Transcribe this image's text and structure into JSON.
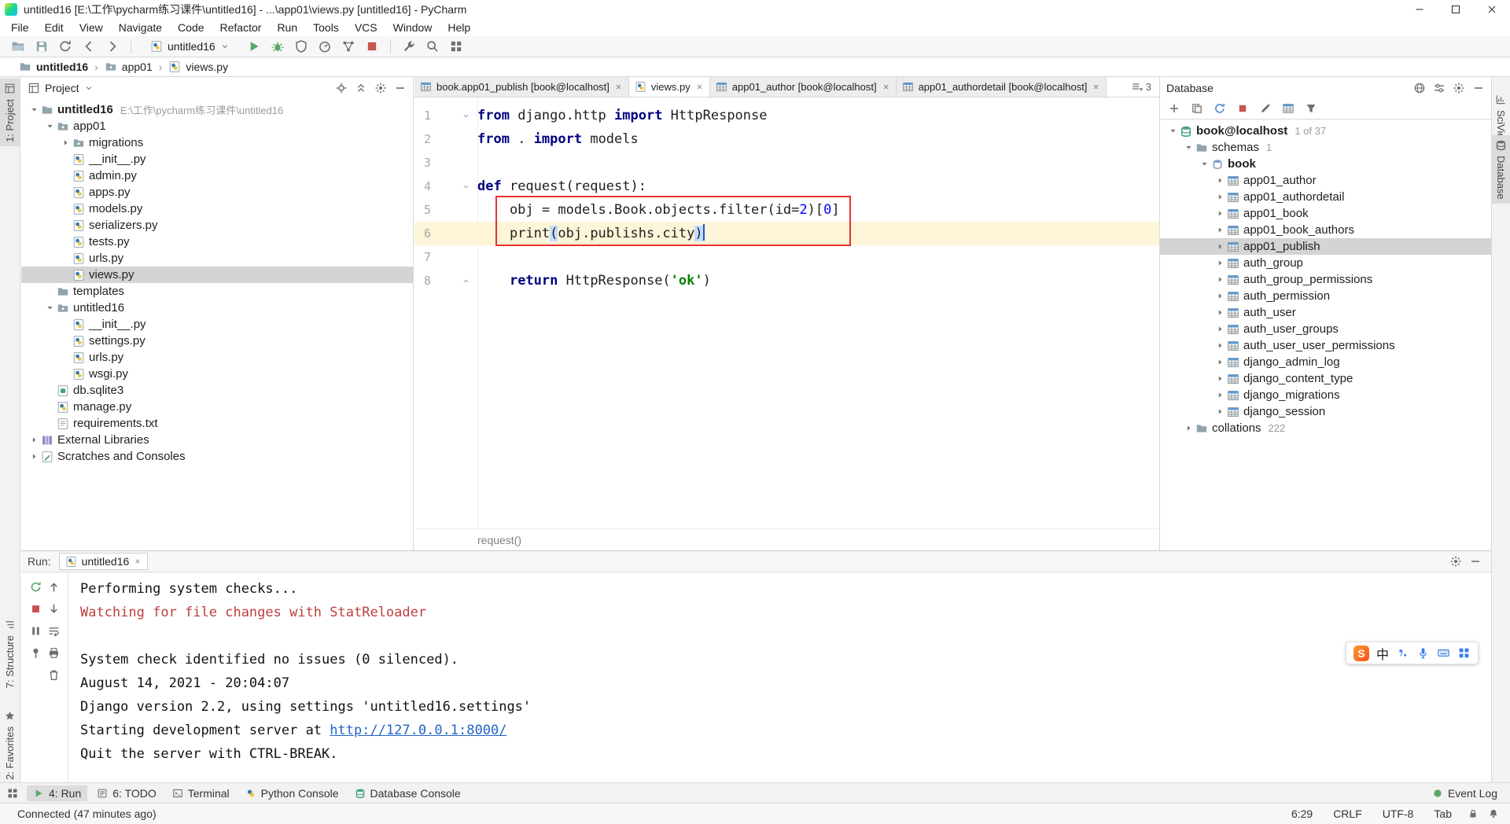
{
  "window": {
    "title": "untitled16 [E:\\工作\\pycharm练习课件\\untitled16] - ...\\app01\\views.py [untitled16] - PyCharm",
    "controls": [
      {
        "icon": "win-min",
        "name": "minimize-button"
      },
      {
        "icon": "win-max",
        "name": "maximize-button"
      },
      {
        "icon": "win-close",
        "name": "close-button"
      }
    ]
  },
  "menu": {
    "items": [
      "File",
      "Edit",
      "View",
      "Navigate",
      "Code",
      "Refactor",
      "Run",
      "Tools",
      "VCS",
      "Window",
      "Help"
    ]
  },
  "toolbar": {
    "file_icons": [
      "open",
      "save",
      "sync",
      "back",
      "forward"
    ],
    "run_config": {
      "icon": "python-file",
      "label": "untitled16"
    },
    "run_icons": [
      "run",
      "debug",
      "coverage",
      "profiler",
      "concurrency",
      "stop"
    ],
    "misc_icons": [
      "wrench",
      "search",
      "grid"
    ]
  },
  "breadcrumbs": {
    "separator": "›",
    "items": [
      {
        "icon": "folder",
        "label": "untitled16",
        "bold": true
      },
      {
        "icon": "package",
        "label": "app01",
        "bold": false
      },
      {
        "icon": "python-file",
        "label": "views.py",
        "bold": false
      }
    ]
  },
  "stripes": {
    "left": [
      {
        "icon": "project-tool",
        "label": "1: Project",
        "active": true
      },
      {
        "icon": "structure-tool",
        "label": "7: Structure",
        "active": false
      },
      {
        "icon": "favorites-tool",
        "label": "2: Favorites",
        "active": false
      }
    ],
    "right": [
      {
        "icon": "sciview-tool",
        "label": "SciView",
        "active": false
      },
      {
        "icon": "database-tool",
        "label": "Database",
        "active": true
      }
    ]
  },
  "project_panel": {
    "title": "Project",
    "header_icons": [
      "locate",
      "collapse-all",
      "settings",
      "hide"
    ],
    "tree": [
      {
        "lvl": 0,
        "exp": "v",
        "icon": "folder",
        "label": "untitled16",
        "extra": "E:\\工作\\pycharm练习课件\\untitled16",
        "bold": true
      },
      {
        "lvl": 1,
        "exp": "v",
        "icon": "package",
        "label": "app01"
      },
      {
        "lvl": 2,
        "exp": ">",
        "icon": "package",
        "label": "migrations"
      },
      {
        "lvl": 2,
        "exp": "",
        "icon": "python-file",
        "label": "__init__.py"
      },
      {
        "lvl": 2,
        "exp": "",
        "icon": "python-file",
        "label": "admin.py"
      },
      {
        "lvl": 2,
        "exp": "",
        "icon": "python-file",
        "label": "apps.py"
      },
      {
        "lvl": 2,
        "exp": "",
        "icon": "python-file",
        "label": "models.py"
      },
      {
        "lvl": 2,
        "exp": "",
        "icon": "python-file",
        "label": "serializers.py"
      },
      {
        "lvl": 2,
        "exp": "",
        "icon": "python-file",
        "label": "tests.py"
      },
      {
        "lvl": 2,
        "exp": "",
        "icon": "python-file",
        "label": "urls.py"
      },
      {
        "lvl": 2,
        "exp": "",
        "icon": "python-file",
        "label": "views.py",
        "selected": true
      },
      {
        "lvl": 1,
        "exp": "",
        "icon": "folder",
        "label": "templates"
      },
      {
        "lvl": 1,
        "exp": "v",
        "icon": "package",
        "label": "untitled16"
      },
      {
        "lvl": 2,
        "exp": "",
        "icon": "python-file",
        "label": "__init__.py"
      },
      {
        "lvl": 2,
        "exp": "",
        "icon": "python-file",
        "label": "settings.py"
      },
      {
        "lvl": 2,
        "exp": "",
        "icon": "python-file",
        "label": "urls.py"
      },
      {
        "lvl": 2,
        "exp": "",
        "icon": "python-file",
        "label": "wsgi.py"
      },
      {
        "lvl": 1,
        "exp": "",
        "icon": "db-file",
        "label": "db.sqlite3"
      },
      {
        "lvl": 1,
        "exp": "",
        "icon": "python-file",
        "label": "manage.py"
      },
      {
        "lvl": 1,
        "exp": "",
        "icon": "text-file",
        "label": "requirements.txt"
      },
      {
        "lvl": 0,
        "exp": ">",
        "icon": "library",
        "label": "External Libraries"
      },
      {
        "lvl": 0,
        "exp": ">",
        "icon": "scratches",
        "label": "Scratches and Consoles"
      }
    ]
  },
  "editor": {
    "tabs": [
      {
        "icon": "table",
        "label": "book.app01_publish [book@localhost]",
        "active": false
      },
      {
        "icon": "python-file",
        "label": "views.py",
        "active": true
      },
      {
        "icon": "table",
        "label": "app01_author [book@localhost]",
        "active": false
      },
      {
        "icon": "table",
        "label": "app01_authordetail [book@localhost]",
        "active": false
      }
    ],
    "hidden_tabs_count": "3",
    "code": {
      "lines": [
        {
          "num": "1",
          "fold": "start",
          "tokens": [
            [
              "from",
              "k"
            ],
            [
              " django.http ",
              "p"
            ],
            [
              "import",
              "k"
            ],
            [
              " HttpResponse",
              "p"
            ]
          ]
        },
        {
          "num": "2",
          "tokens": [
            [
              "from",
              "k"
            ],
            [
              " . ",
              "p"
            ],
            [
              "import",
              "k"
            ],
            [
              " models",
              "p"
            ]
          ]
        },
        {
          "num": "3",
          "tokens": []
        },
        {
          "num": "4",
          "fold": "start",
          "tokens": [
            [
              "def",
              "k"
            ],
            [
              " request(request):",
              "p"
            ]
          ]
        },
        {
          "num": "5",
          "tokens": [
            [
              "    obj = models.Book.objects.filter(id=",
              "p"
            ],
            [
              "2",
              "n"
            ],
            [
              ")[",
              "p"
            ],
            [
              "0",
              "n"
            ],
            [
              "]",
              "p"
            ]
          ]
        },
        {
          "num": "6",
          "current": true,
          "cursor": true,
          "tokens": [
            [
              "    print",
              "p"
            ],
            [
              "(",
              "m"
            ],
            [
              "obj.publishs.city",
              "p"
            ],
            [
              ")",
              "m"
            ]
          ]
        },
        {
          "num": "7",
          "tokens": []
        },
        {
          "num": "8",
          "fold": "end",
          "tokens": [
            [
              "    ",
              "p"
            ],
            [
              "return",
              "k"
            ],
            [
              " HttpResponse(",
              "p"
            ],
            [
              "'ok'",
              "s"
            ],
            [
              ")",
              "p"
            ]
          ]
        }
      ]
    },
    "footer_breadcrumb": "request()"
  },
  "database_panel": {
    "title": "Database",
    "header_icons": [
      "globe",
      "sliders",
      "settings",
      "hide"
    ],
    "toolbar_icons": [
      "plus",
      "copy",
      "refresh",
      "stop-red",
      "edit",
      "table",
      "funnel"
    ],
    "tree": [
      {
        "lvl": 0,
        "exp": "v",
        "icon": "database",
        "label": "book@localhost",
        "extra": "1 of 37",
        "bold": true
      },
      {
        "lvl": 1,
        "exp": "v",
        "icon": "folder",
        "label": "schemas",
        "extra": "1"
      },
      {
        "lvl": 2,
        "exp": "v",
        "icon": "schema",
        "label": "book",
        "bold": true
      },
      {
        "lvl": 3,
        "exp": ">",
        "icon": "table",
        "label": "app01_author"
      },
      {
        "lvl": 3,
        "exp": ">",
        "icon": "table",
        "label": "app01_authordetail"
      },
      {
        "lvl": 3,
        "exp": ">",
        "icon": "table",
        "label": "app01_book"
      },
      {
        "lvl": 3,
        "exp": ">",
        "icon": "table",
        "label": "app01_book_authors"
      },
      {
        "lvl": 3,
        "exp": ">",
        "icon": "table",
        "label": "app01_publish",
        "selected": true
      },
      {
        "lvl": 3,
        "exp": ">",
        "icon": "table",
        "label": "auth_group"
      },
      {
        "lvl": 3,
        "exp": ">",
        "icon": "table",
        "label": "auth_group_permissions"
      },
      {
        "lvl": 3,
        "exp": ">",
        "icon": "table",
        "label": "auth_permission"
      },
      {
        "lvl": 3,
        "exp": ">",
        "icon": "table",
        "label": "auth_user"
      },
      {
        "lvl": 3,
        "exp": ">",
        "icon": "table",
        "label": "auth_user_groups"
      },
      {
        "lvl": 3,
        "exp": ">",
        "icon": "table",
        "label": "auth_user_user_permissions"
      },
      {
        "lvl": 3,
        "exp": ">",
        "icon": "table",
        "label": "django_admin_log"
      },
      {
        "lvl": 3,
        "exp": ">",
        "icon": "table",
        "label": "django_content_type"
      },
      {
        "lvl": 3,
        "exp": ">",
        "icon": "table",
        "label": "django_migrations"
      },
      {
        "lvl": 3,
        "exp": ">",
        "icon": "table",
        "label": "django_session"
      },
      {
        "lvl": 1,
        "exp": ">",
        "icon": "folder",
        "label": "collations",
        "extra": "222"
      }
    ]
  },
  "run_panel": {
    "label": "Run:",
    "tab": {
      "icon": "python-file",
      "label": "untitled16"
    },
    "header_icons": [
      "settings",
      "hide"
    ],
    "toolbar_a": [
      "rerun",
      "stop-red",
      "pause",
      "pin"
    ],
    "toolbar_b": [
      "up",
      "down",
      "softwrap",
      "print",
      "trash"
    ],
    "output": [
      {
        "text": "Performing system checks...",
        "style": "plain"
      },
      {
        "text": "Watching for file changes with StatReloader",
        "style": "error"
      },
      {
        "text": "",
        "style": "plain"
      },
      {
        "text": "System check identified no issues (0 silenced).",
        "style": "plain"
      },
      {
        "text": "August 14, 2021 - 20:04:07",
        "style": "plain"
      },
      {
        "text": "Django version 2.2, using settings 'untitled16.settings'",
        "style": "plain"
      },
      {
        "text": "Starting development server at ",
        "style": "plain",
        "link": "http://127.0.0.1:8000/"
      },
      {
        "text": "Quit the server with CTRL-BREAK.",
        "style": "plain"
      }
    ]
  },
  "ime": {
    "logo": "S",
    "mode": "中",
    "icons": [
      "punct",
      "mic",
      "keyboard",
      "apps"
    ]
  },
  "tool_tabs": {
    "left": [
      {
        "icon": "run",
        "label": "4: Run",
        "active": true
      },
      {
        "icon": "todo",
        "label": "6: TODO",
        "active": false
      },
      {
        "icon": "terminal",
        "label": "Terminal",
        "active": false
      },
      {
        "icon": "python-console",
        "label": "Python Console",
        "active": false
      },
      {
        "icon": "db-console",
        "label": "Database Console",
        "active": false
      }
    ],
    "right": [
      {
        "icon": "event",
        "label": "Event Log",
        "active": false
      }
    ]
  },
  "status_bar": {
    "left": "Connected (47 minutes ago)",
    "right_items": [
      "6:29",
      "CRLF",
      "UTF-8",
      "Tab"
    ],
    "right_icons": [
      "lock",
      "bell"
    ]
  },
  "colors": {
    "keyword": "#000080",
    "string": "#008000",
    "number": "#0000FF",
    "console_error": "#BC3F3C",
    "link": "#2065C7",
    "annotation_box": "#E8322E",
    "selection": "#D4D4D4",
    "current_line": "#FCF5D8",
    "run_green": "#59A869",
    "stop_red": "#C75450",
    "db_teal": "#45A08C"
  }
}
